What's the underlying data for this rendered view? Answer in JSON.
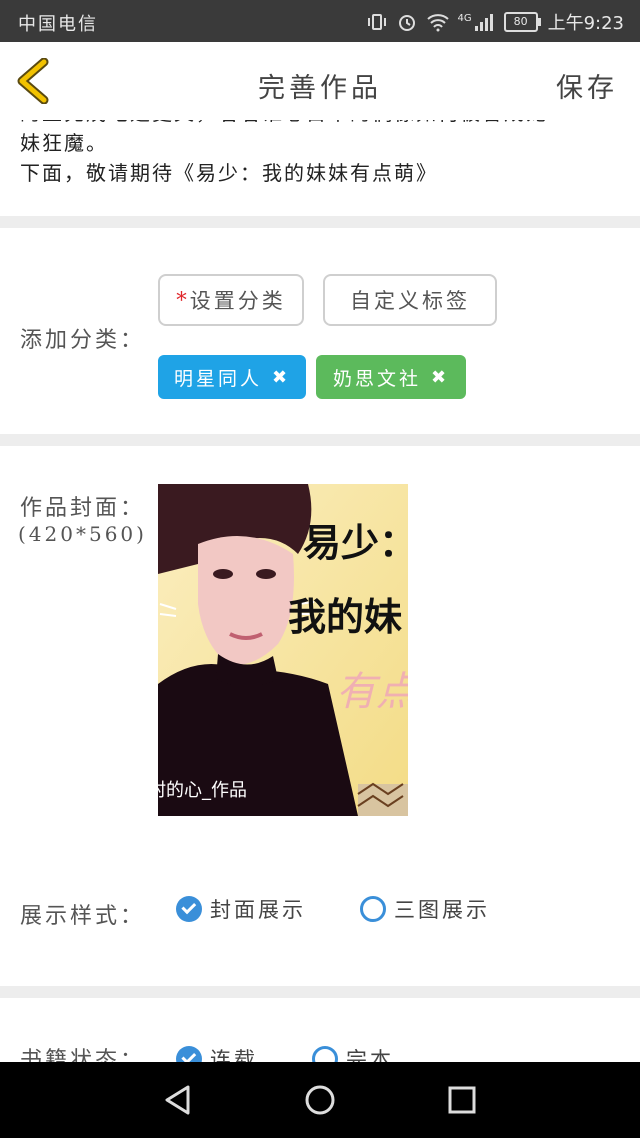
{
  "status_bar": {
    "carrier": "中国电信",
    "network": "4G",
    "battery": "80",
    "time": "上午9:23"
  },
  "header": {
    "title": "完善作品",
    "save_label": "保存"
  },
  "description": {
    "lines": [
      "的上充戊电翅更文，看看谁心目中的偶像如何被誉成宠",
      "妹狂魔。",
      "下面，敬请期待《易少：我的妹妹有点萌》"
    ]
  },
  "category": {
    "label": "添加分类：",
    "required_mark": "*",
    "set_category_label": "设置分类",
    "custom_tag_label": "自定义标签",
    "tags": [
      {
        "label": "明星同人",
        "remove": "✖",
        "color": "#1fa3e6"
      },
      {
        "label": "奶思文社",
        "remove": "✖",
        "color": "#5cba5c"
      }
    ]
  },
  "cover": {
    "label": "作品封面：",
    "size_hint": "(420*560)",
    "image_title_1": "易少：",
    "image_title_2": "我的妹",
    "image_title_3": "有点",
    "image_credit": "村的心_作品"
  },
  "display": {
    "label": "展示样式：",
    "options": [
      {
        "label": "封面展示",
        "selected": true
      },
      {
        "label": "三图展示",
        "selected": false
      }
    ]
  },
  "book_status": {
    "label": "书籍状态：",
    "options": [
      {
        "label": "连载",
        "selected": true
      },
      {
        "label": "完本",
        "selected": false
      }
    ]
  },
  "colors": {
    "accent": "#3a8fd9",
    "back_arrow": "#f2c200"
  }
}
